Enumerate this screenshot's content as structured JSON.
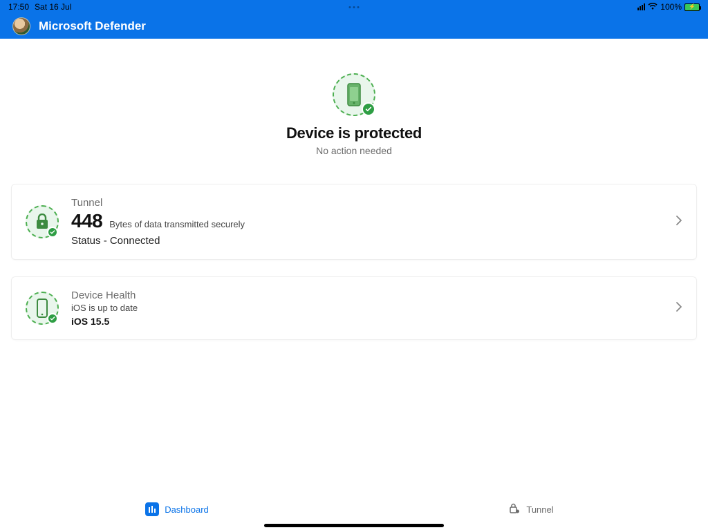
{
  "status_bar": {
    "time": "17:50",
    "date": "Sat 16 Jul",
    "battery_percent": "100%"
  },
  "header": {
    "title": "Microsoft Defender"
  },
  "hero": {
    "title": "Device is protected",
    "subtitle": "No action needed"
  },
  "cards": {
    "tunnel": {
      "label": "Tunnel",
      "value": "448",
      "desc": "Bytes of data transmitted securely",
      "status": "Status - Connected"
    },
    "device_health": {
      "label": "Device Health",
      "line2": "iOS is up to date",
      "version": "iOS 15.5"
    }
  },
  "tabs": {
    "dashboard": "Dashboard",
    "tunnel": "Tunnel"
  },
  "colors": {
    "primary": "#0a73e8",
    "success": "#2e9e44"
  }
}
